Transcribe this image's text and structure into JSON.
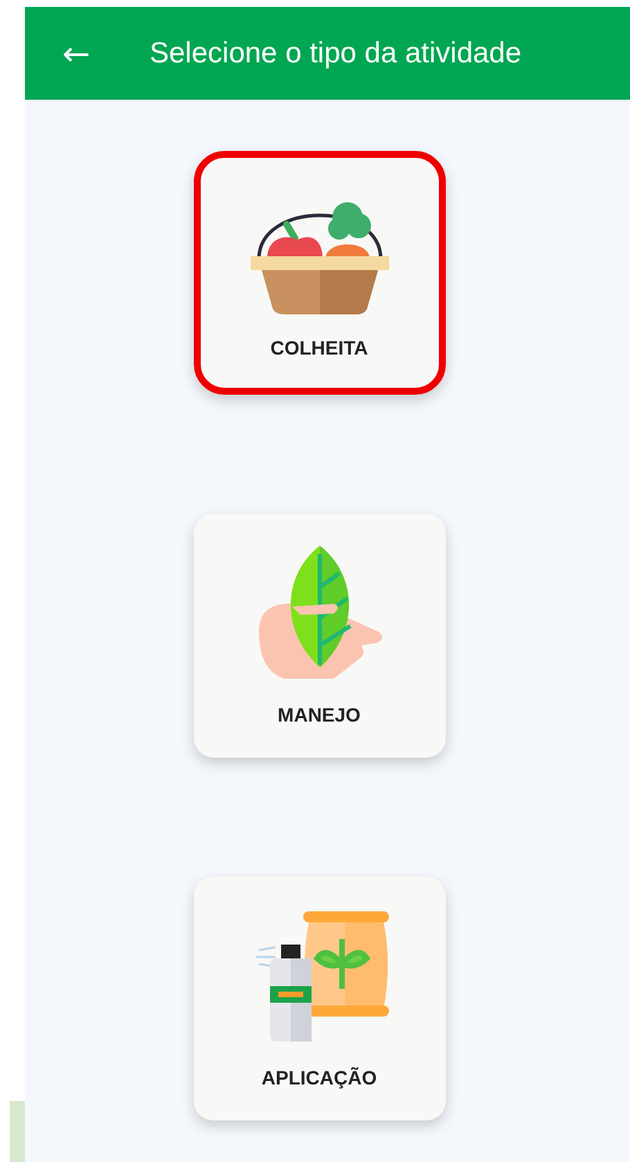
{
  "header": {
    "back_icon": "←",
    "title": "Selecione o tipo da atividade"
  },
  "activities": [
    {
      "label": "COLHEITA",
      "kind": "basket",
      "selected": true
    },
    {
      "label": "MANEJO",
      "kind": "leaf-hand",
      "selected": false
    },
    {
      "label": "APLICAÇÃO",
      "kind": "sprayer",
      "selected": false
    }
  ]
}
